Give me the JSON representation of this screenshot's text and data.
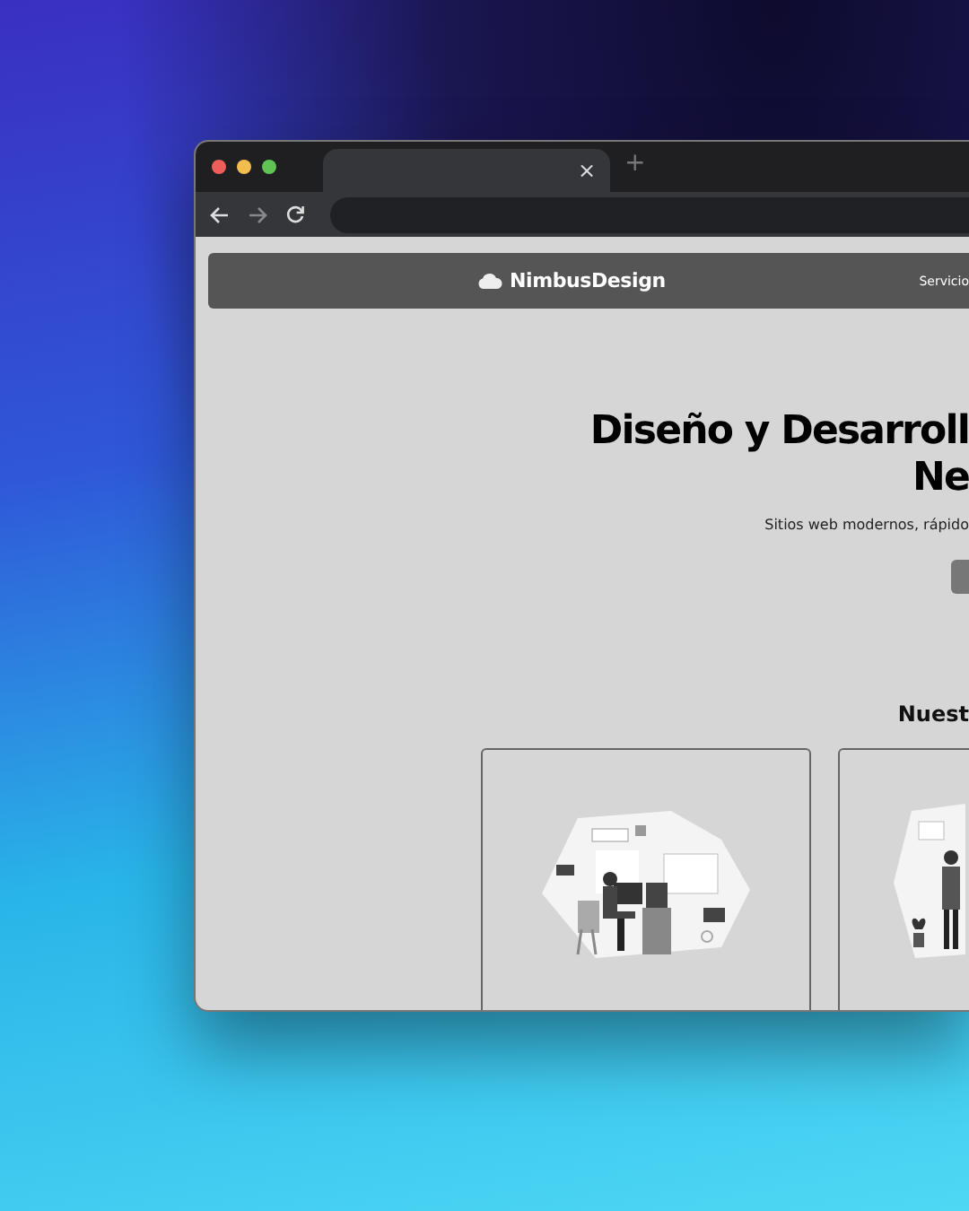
{
  "browser": {
    "tab_close": "×",
    "new_tab": "+"
  },
  "nav": {
    "brand": "NimbusDesign",
    "links": [
      "Servicio"
    ]
  },
  "hero": {
    "title_lines": [
      "Diseño y Desarroll",
      "Ne"
    ],
    "subtitle": "Sitios web modernos, rápido"
  },
  "services": {
    "heading": "Nuest",
    "cards": [
      {
        "kind": "desk"
      },
      {
        "kind": "standing"
      }
    ]
  }
}
